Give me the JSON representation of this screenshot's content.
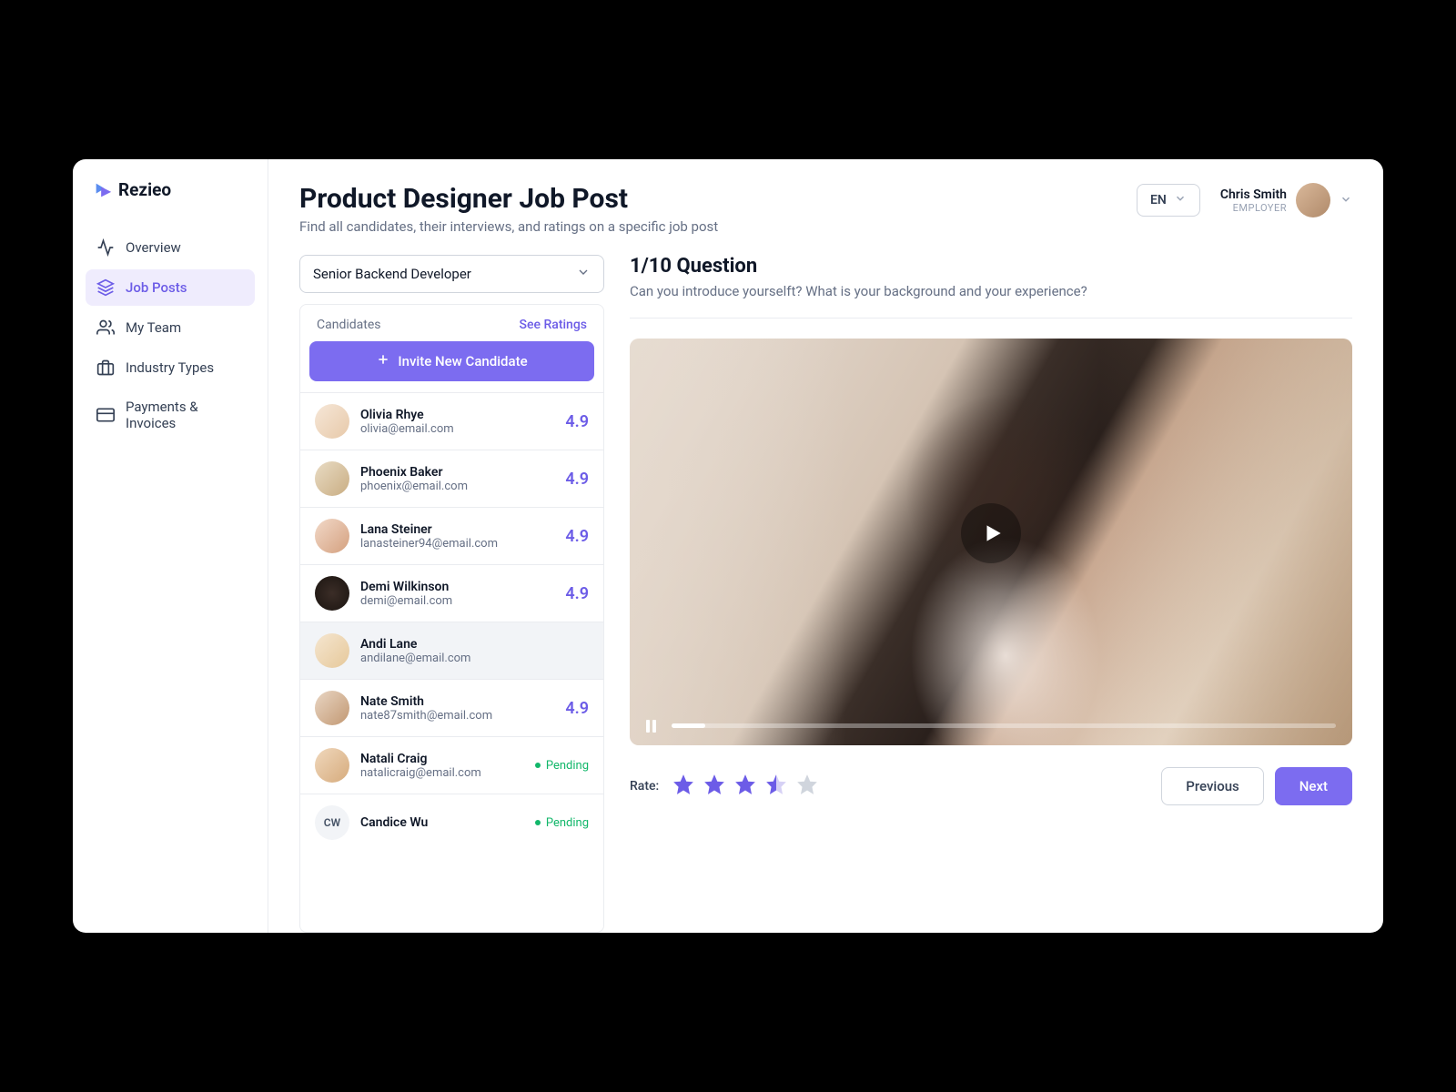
{
  "brand": "Rezieo",
  "sidebar": {
    "items": [
      {
        "label": "Overview",
        "icon": "activity"
      },
      {
        "label": "Job Posts",
        "icon": "layers",
        "active": true
      },
      {
        "label": "My Team",
        "icon": "users"
      },
      {
        "label": "Industry Types",
        "icon": "briefcase"
      },
      {
        "label": "Payments & Invoices",
        "icon": "credit-card"
      }
    ]
  },
  "header": {
    "title": "Product Designer Job Post",
    "subtitle": "Find all candidates, their interviews, and ratings on a specific job post",
    "language": "EN",
    "user_name": "Chris Smith",
    "user_role": "EMPLOYER"
  },
  "job_select": {
    "value": "Senior Backend Developer"
  },
  "candidates_panel": {
    "label": "Candidates",
    "see_ratings": "See Ratings",
    "invite_label": "Invite New Candidate"
  },
  "candidates": [
    {
      "name": "Olivia Rhye",
      "email": "olivia@email.com",
      "rating": "4.9",
      "avatar_bg": "linear-gradient(135deg,#f6e7d8,#e7c9a9)"
    },
    {
      "name": "Phoenix Baker",
      "email": "phoenix@email.com",
      "rating": "4.9",
      "avatar_bg": "linear-gradient(135deg,#e9dcc5,#c9ad82)"
    },
    {
      "name": "Lana Steiner",
      "email": "lanasteiner94@email.com",
      "rating": "4.9",
      "avatar_bg": "linear-gradient(135deg,#f2d9c9,#d4a07e)"
    },
    {
      "name": "Demi Wilkinson",
      "email": "demi@email.com",
      "rating": "4.9",
      "avatar_bg": "radial-gradient(circle,#3b2d27,#1a1410)"
    },
    {
      "name": "Andi Lane",
      "email": "andilane@email.com",
      "selected": true,
      "avatar_bg": "linear-gradient(135deg,#f5e6d0,#e6c89a)"
    },
    {
      "name": "Nate Smith",
      "email": "nate87smith@email.com",
      "rating": "4.9",
      "avatar_bg": "linear-gradient(135deg,#e9d6c4,#c29872)"
    },
    {
      "name": "Natali Craig",
      "email": "natalicraig@email.com",
      "pending": true,
      "avatar_bg": "linear-gradient(135deg,#f0d8bd,#d6ab7c)"
    },
    {
      "name": "Candice Wu",
      "email": "",
      "pending": true,
      "initials": "CW",
      "avatar_bg": "#f2f4f7"
    }
  ],
  "question": {
    "counter": "1/10 Question",
    "text": "Can you introduce yourselft? What is your background and your experience?"
  },
  "rate": {
    "label": "Rate:",
    "value": 3.5,
    "max": 5
  },
  "buttons": {
    "prev": "Previous",
    "next": "Next"
  },
  "pending_label": "Pending"
}
